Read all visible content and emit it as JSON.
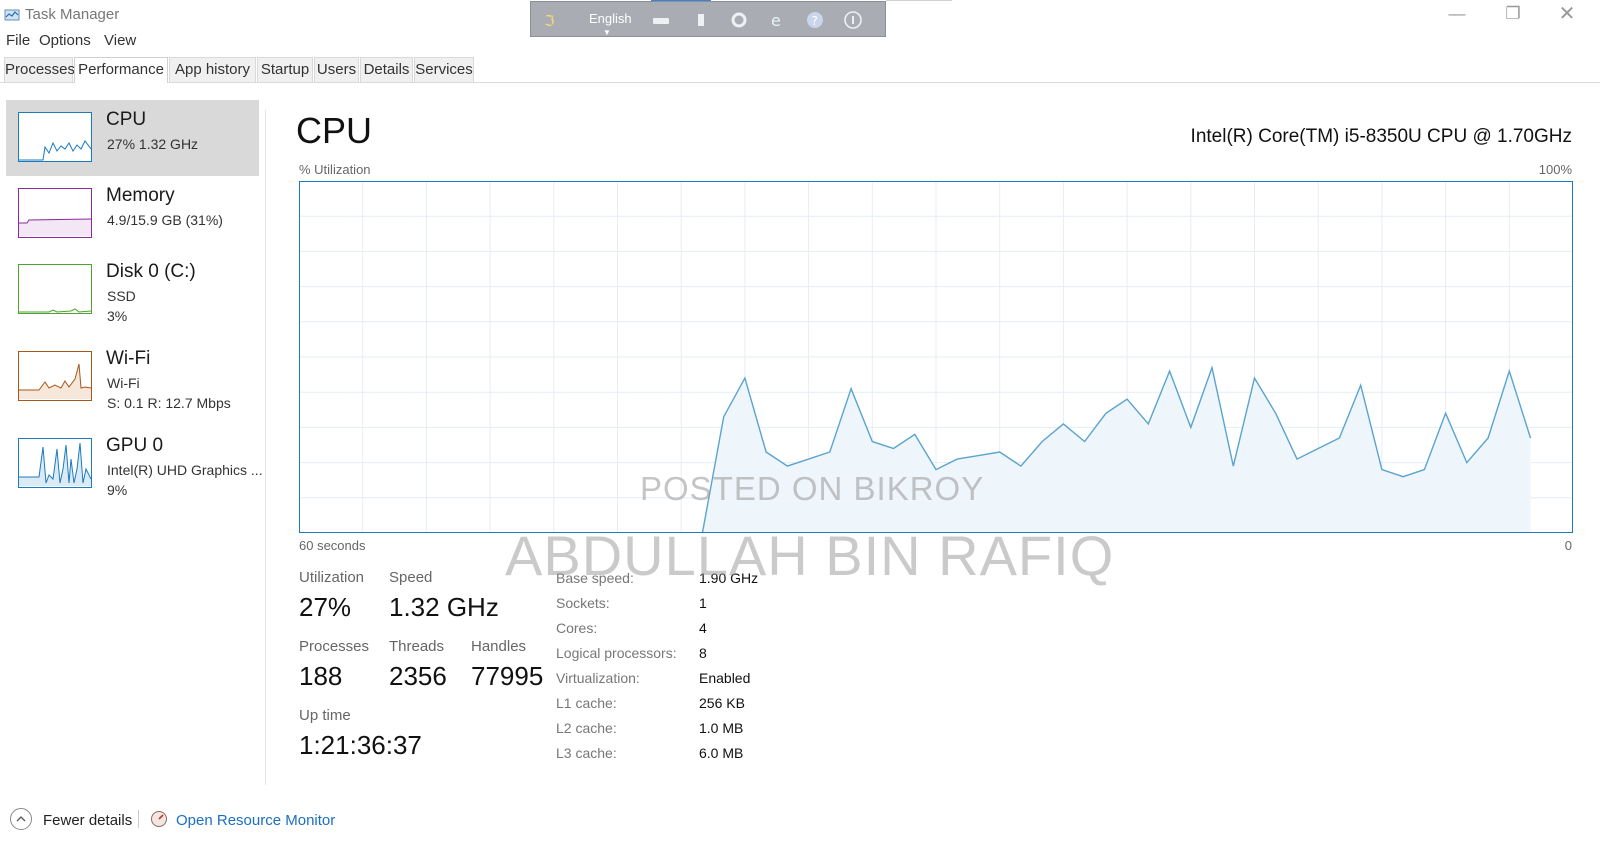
{
  "window": {
    "title": "Task Manager"
  },
  "language_bar": {
    "label": "English"
  },
  "menu": [
    "File",
    "Options",
    "View"
  ],
  "tabs": [
    {
      "label": "Processes",
      "active": false
    },
    {
      "label": "Performance",
      "active": true
    },
    {
      "label": "App history",
      "active": false
    },
    {
      "label": "Startup",
      "active": false
    },
    {
      "label": "Users",
      "active": false
    },
    {
      "label": "Details",
      "active": false
    },
    {
      "label": "Services",
      "active": false
    }
  ],
  "sidebar": {
    "items": [
      {
        "title": "CPU",
        "line1": "27%  1.32 GHz",
        "line2": "",
        "color": "#1a7bbf",
        "selected": true
      },
      {
        "title": "Memory",
        "line1": "4.9/15.9 GB (31%)",
        "line2": "",
        "color": "#8b2a9e",
        "selected": false
      },
      {
        "title": "Disk 0 (C:)",
        "line1": "SSD",
        "line2": "3%",
        "color": "#4da32f",
        "selected": false
      },
      {
        "title": "Wi-Fi",
        "line1": "Wi-Fi",
        "line2": "S: 0.1  R: 12.7 Mbps",
        "color": "#a8571b",
        "selected": false
      },
      {
        "title": "GPU 0",
        "line1": "Intel(R) UHD Graphics ...",
        "line2": "9%",
        "color": "#1a7bbf",
        "selected": false
      }
    ]
  },
  "main": {
    "title": "CPU",
    "model": "Intel(R) Core(TM) i5-8350U CPU @ 1.70GHz",
    "util_label": "% Utilization",
    "util_max": "100%",
    "time_left": "60 seconds",
    "time_right": "0",
    "stats": {
      "utilization": {
        "label": "Utilization",
        "value": "27%"
      },
      "speed": {
        "label": "Speed",
        "value": "1.32 GHz"
      },
      "processes": {
        "label": "Processes",
        "value": "188"
      },
      "threads": {
        "label": "Threads",
        "value": "2356"
      },
      "handles": {
        "label": "Handles",
        "value": "77995"
      },
      "uptime": {
        "label": "Up time",
        "value": "1:21:36:37"
      }
    },
    "specs": [
      {
        "label": "Base speed:",
        "value": "1.90 GHz"
      },
      {
        "label": "Sockets:",
        "value": "1"
      },
      {
        "label": "Cores:",
        "value": "4"
      },
      {
        "label": "Logical processors:",
        "value": "8"
      },
      {
        "label": "Virtualization:",
        "value": "Enabled"
      },
      {
        "label": "L1 cache:",
        "value": "256 KB"
      },
      {
        "label": "L2 cache:",
        "value": "1.0 MB"
      },
      {
        "label": "L3 cache:",
        "value": "6.0 MB"
      }
    ]
  },
  "watermarks": [
    "POSTED ON BIKROY",
    "ABDULLAH BIN RAFIQ"
  ],
  "footer": {
    "fewer_details": "Fewer details",
    "resource_monitor": "Open Resource Monitor"
  },
  "chart_data": {
    "type": "area",
    "xlabel": "60 seconds",
    "ylabel": "% Utilization",
    "ylim": [
      0,
      100
    ],
    "x": [
      60,
      59,
      58,
      57,
      56,
      55,
      54,
      53,
      52,
      51,
      50,
      49,
      48,
      47,
      46,
      45,
      44,
      43,
      42,
      41,
      40,
      39,
      38,
      37,
      36,
      35,
      34,
      33,
      32,
      31,
      30,
      29,
      28,
      27,
      26,
      25,
      24,
      23,
      22,
      21,
      20,
      19,
      18,
      17,
      16,
      15,
      14,
      13,
      12,
      11,
      10,
      9,
      8,
      7,
      6,
      5,
      4,
      3,
      2,
      1,
      0
    ],
    "values": [
      0,
      0,
      0,
      0,
      0,
      0,
      0,
      0,
      0,
      0,
      0,
      0,
      0,
      0,
      0,
      0,
      0,
      0,
      0,
      0,
      33,
      44,
      23,
      19,
      21,
      23,
      41,
      26,
      24,
      28,
      18,
      21,
      22,
      23,
      19,
      26,
      31,
      26,
      34,
      38,
      31,
      46,
      30,
      47,
      19,
      44,
      34,
      21,
      24,
      27,
      42,
      18,
      16,
      18,
      34,
      20,
      27,
      46,
      27,
      null,
      null
    ],
    "grid": true,
    "color": "#1a7bbf"
  }
}
